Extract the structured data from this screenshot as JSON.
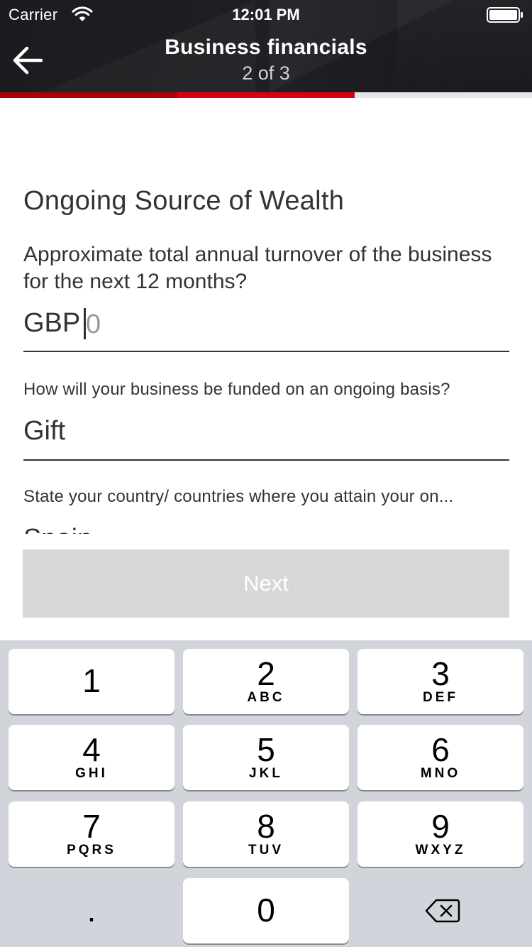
{
  "status_bar": {
    "carrier": "Carrier",
    "time": "12:01 PM"
  },
  "header": {
    "title": "Business financials",
    "step": "2 of 3",
    "back_icon": "arrow-left-icon",
    "progress_fraction": 0.667
  },
  "form": {
    "section_title": "Ongoing Source of Wealth",
    "turnover_question": "Approximate total annual turnover of the business for the next 12 months?",
    "turnover_currency": "GBP",
    "turnover_placeholder": "0",
    "funding_question": "How will your business be funded on an ongoing basis?",
    "funding_value": "Gift",
    "countries_question": "State your country/ countries where you attain your on...",
    "countries_value": "Spain"
  },
  "next_button": {
    "label": "Next"
  },
  "keyboard": {
    "keys": [
      {
        "digit": "1",
        "letters": ""
      },
      {
        "digit": "2",
        "letters": "ABC"
      },
      {
        "digit": "3",
        "letters": "DEF"
      },
      {
        "digit": "4",
        "letters": "GHI"
      },
      {
        "digit": "5",
        "letters": "JKL"
      },
      {
        "digit": "6",
        "letters": "MNO"
      },
      {
        "digit": "7",
        "letters": "PQRS"
      },
      {
        "digit": "8",
        "letters": "TUV"
      },
      {
        "digit": "9",
        "letters": "WXYZ"
      },
      {
        "digit": "0",
        "letters": ""
      }
    ],
    "decimal": ".",
    "delete_icon": "backspace-icon"
  },
  "colors": {
    "brand_red": "#db0011",
    "header_dark": "#1e2024",
    "button_disabled": "#d7d7d7",
    "keyboard_bg": "#d1d4da"
  }
}
